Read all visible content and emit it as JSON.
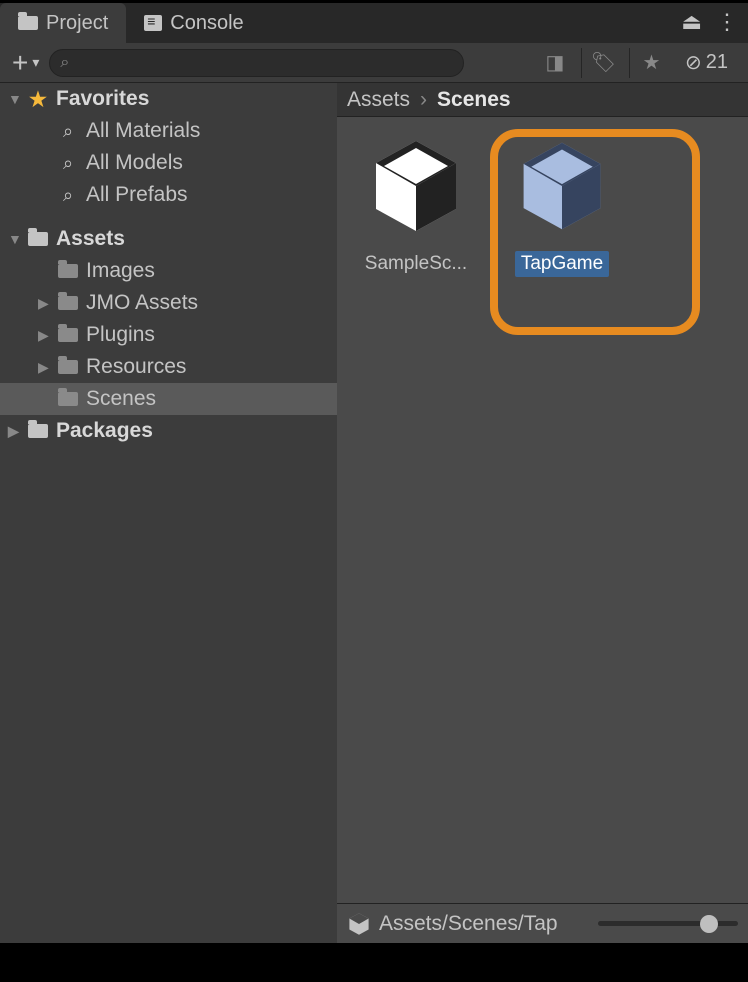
{
  "tabs": {
    "project": "Project",
    "console": "Console"
  },
  "hidden_count": "21",
  "search": {
    "placeholder": ""
  },
  "sidebar": {
    "favorites": {
      "label": "Favorites",
      "items": [
        "All Materials",
        "All Models",
        "All Prefabs"
      ]
    },
    "assets": {
      "label": "Assets",
      "items": [
        "Images",
        "JMO Assets",
        "Plugins",
        "Resources",
        "Scenes"
      ]
    },
    "packages": {
      "label": "Packages"
    }
  },
  "breadcrumb": {
    "root": "Assets",
    "current": "Scenes"
  },
  "assets_grid": [
    {
      "label": "SampleSc...",
      "selected": false
    },
    {
      "label": "TapGame",
      "selected": true
    }
  ],
  "footer": {
    "path": "Assets/Scenes/Tap"
  }
}
